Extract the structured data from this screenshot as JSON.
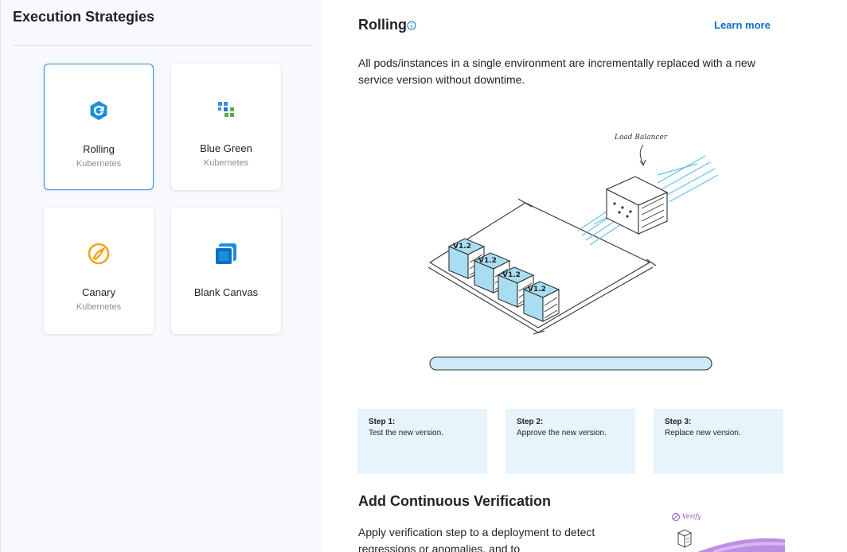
{
  "left_panel": {
    "title": "Execution Strategies",
    "cards": [
      {
        "name": "Rolling",
        "sub": "Kubernetes",
        "icon": "rolling-icon",
        "selected": true
      },
      {
        "name": "Blue Green",
        "sub": "Kubernetes",
        "icon": "blue-green-icon",
        "selected": false
      },
      {
        "name": "Canary",
        "sub": "Kubernetes",
        "icon": "canary-icon",
        "selected": false
      },
      {
        "name": "Blank Canvas",
        "sub": "",
        "icon": "blank-canvas-icon",
        "selected": false
      }
    ]
  },
  "detail": {
    "title": "Rolling",
    "learn_more": "Learn more",
    "description": "All pods/instances in a single environment are incrementally replaced with a new service version without downtime.",
    "diagram": {
      "load_balancer_label": "Load Balancer",
      "instance_labels": [
        "V1.2",
        "V1.2",
        "V1.2",
        "V1.2"
      ]
    },
    "steps": [
      {
        "label": "Step 1:",
        "text": "Test the new version."
      },
      {
        "label": "Step 2:",
        "text": "Approve the new version."
      },
      {
        "label": "Step 3:",
        "text": "Replace new version."
      }
    ],
    "verification": {
      "title": "Add Continuous Verification",
      "text": "Apply verification step to a deployment to detect regressions or anomalies, and to",
      "illustration_label": "Verify"
    }
  },
  "colors": {
    "accent": "#0b70c6",
    "selected_border": "#3d8fd6",
    "step_bg": "#e8f4fb",
    "diagram_blue": "#a8ddf2"
  }
}
